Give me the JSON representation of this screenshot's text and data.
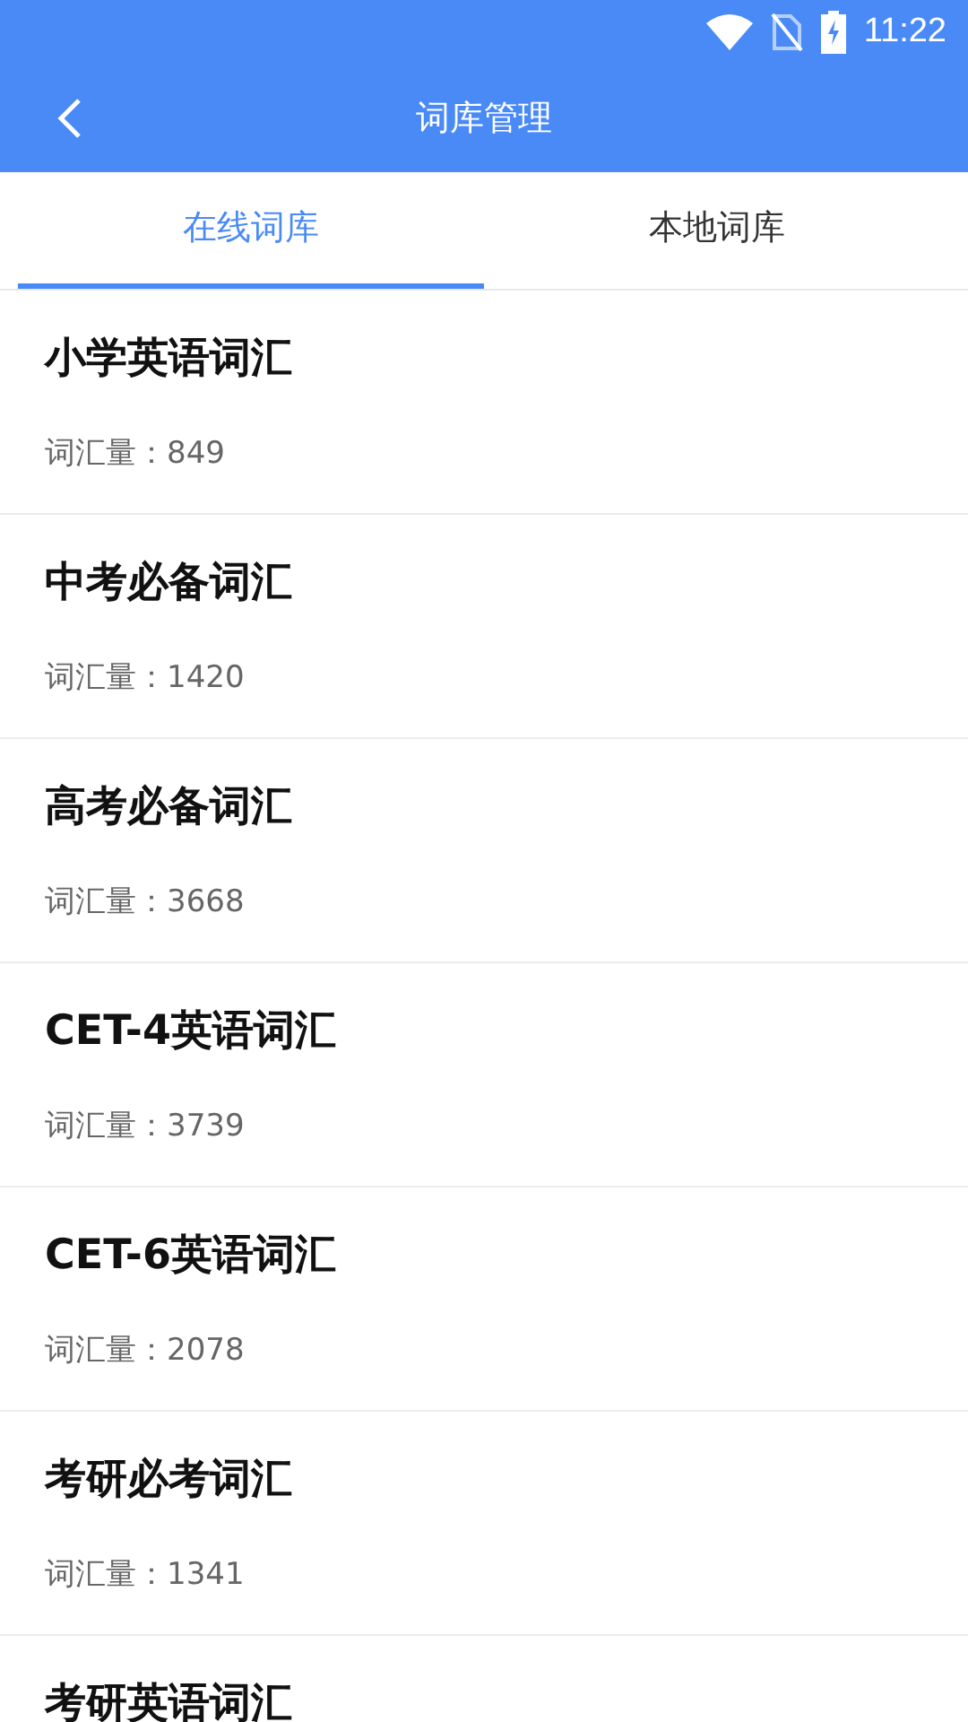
{
  "status_bar": {
    "time": "11:22"
  },
  "app_bar": {
    "title": "词库管理"
  },
  "tabs": [
    {
      "label": "在线词库",
      "selected": true
    },
    {
      "label": "本地词库",
      "selected": false
    }
  ],
  "word_lists": [
    {
      "name": "小学英语词汇",
      "count": "词汇量：849"
    },
    {
      "name": "中考必备词汇",
      "count": "词汇量：1420"
    },
    {
      "name": "高考必备词汇",
      "count": "词汇量：3668"
    },
    {
      "name": "CET-4英语词汇",
      "count": "词汇量：3739"
    },
    {
      "name": "CET-6英语词汇",
      "count": "词汇量：2078"
    },
    {
      "name": "考研必考词汇",
      "count": "词汇量：1341"
    },
    {
      "name": "考研英语词汇"
    }
  ]
}
